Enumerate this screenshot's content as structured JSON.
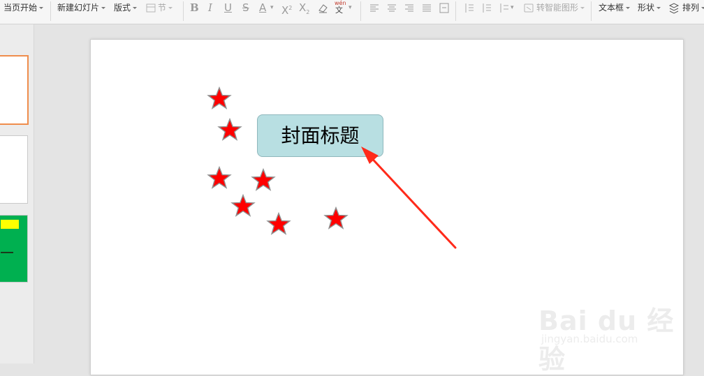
{
  "toolbar": {
    "items": {
      "current_page_start": "当页开始",
      "new_slide": "新建幻灯片",
      "layout": "版式",
      "section": "节",
      "smart_shape": "转智能图形",
      "textbox": "文本框",
      "shape": "形状",
      "arrange": "排列"
    },
    "pinyin_top": "wén",
    "pinyin_char": "文"
  },
  "slide": {
    "title_text": "封面标题",
    "star_color": "#ff0000",
    "arrow_color": "#ff2a1a",
    "title_bg": "#b8dfe2"
  },
  "thumbnails": [
    {
      "type": "blank",
      "selected": true
    },
    {
      "type": "blank",
      "selected": false
    },
    {
      "type": "green",
      "selected": false
    }
  ],
  "watermark": {
    "main": "Bai du 经验",
    "sub": "jingyan.baidu.com"
  }
}
